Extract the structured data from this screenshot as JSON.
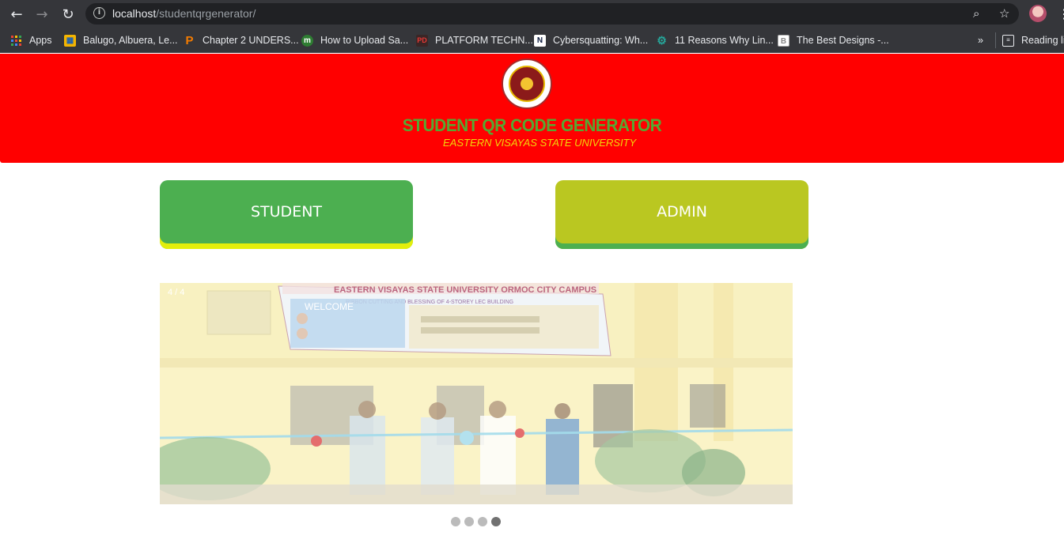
{
  "browser": {
    "url_host": "localhost",
    "url_path": "/studentqrgenerator/",
    "bookmarks": [
      {
        "label": "Apps",
        "icon": "apps-grid-icon"
      },
      {
        "label": "Balugo, Albuera, Le...",
        "icon": "map-icon",
        "color": "#f4b400"
      },
      {
        "label": "Chapter 2 UNDERS...",
        "icon": "p-icon",
        "color": "#f57c00"
      },
      {
        "label": "How to Upload Sa...",
        "icon": "m-icon",
        "color": "#43a047"
      },
      {
        "label": "PLATFORM TECHN...",
        "icon": "pd-icon",
        "color": "#c62828"
      },
      {
        "label": "Cybersquatting: Wh...",
        "icon": "n-icon",
        "color": "#0d1b3e"
      },
      {
        "label": "11 Reasons Why Lin...",
        "icon": "gear-icon",
        "color": "#26a69a"
      },
      {
        "label": "The Best Designs -...",
        "icon": "b-icon",
        "color": "#ffffff"
      }
    ],
    "overflow_label": "»",
    "reading_list_label": "Reading lis"
  },
  "header": {
    "logo_icon": "university-seal-icon",
    "title": "STUDENT QR CODE GENERATOR",
    "subtitle": "EASTERN VISAYAS STATE UNIVERSITY"
  },
  "buttons": {
    "student_label": "STUDENT",
    "admin_label": "ADMIN"
  },
  "slideshow": {
    "counter": "4 / 4",
    "banner_title": "EASTERN VISAYAS STATE UNIVERSITY ORMOC CITY CAMPUS",
    "banner_subtitle": "RIBBON CUTTING AND BLESSING OF 4-STOREY LEC BUILDING",
    "banner_welcome": "WELCOME",
    "slide_count": 4,
    "active_index": 4
  },
  "colors": {
    "header_bg": "#ff0000",
    "title_green": "#56a832",
    "subtitle_yellow": "#f2d50a",
    "student_btn": "#4caf50",
    "admin_btn": "#bac721"
  }
}
